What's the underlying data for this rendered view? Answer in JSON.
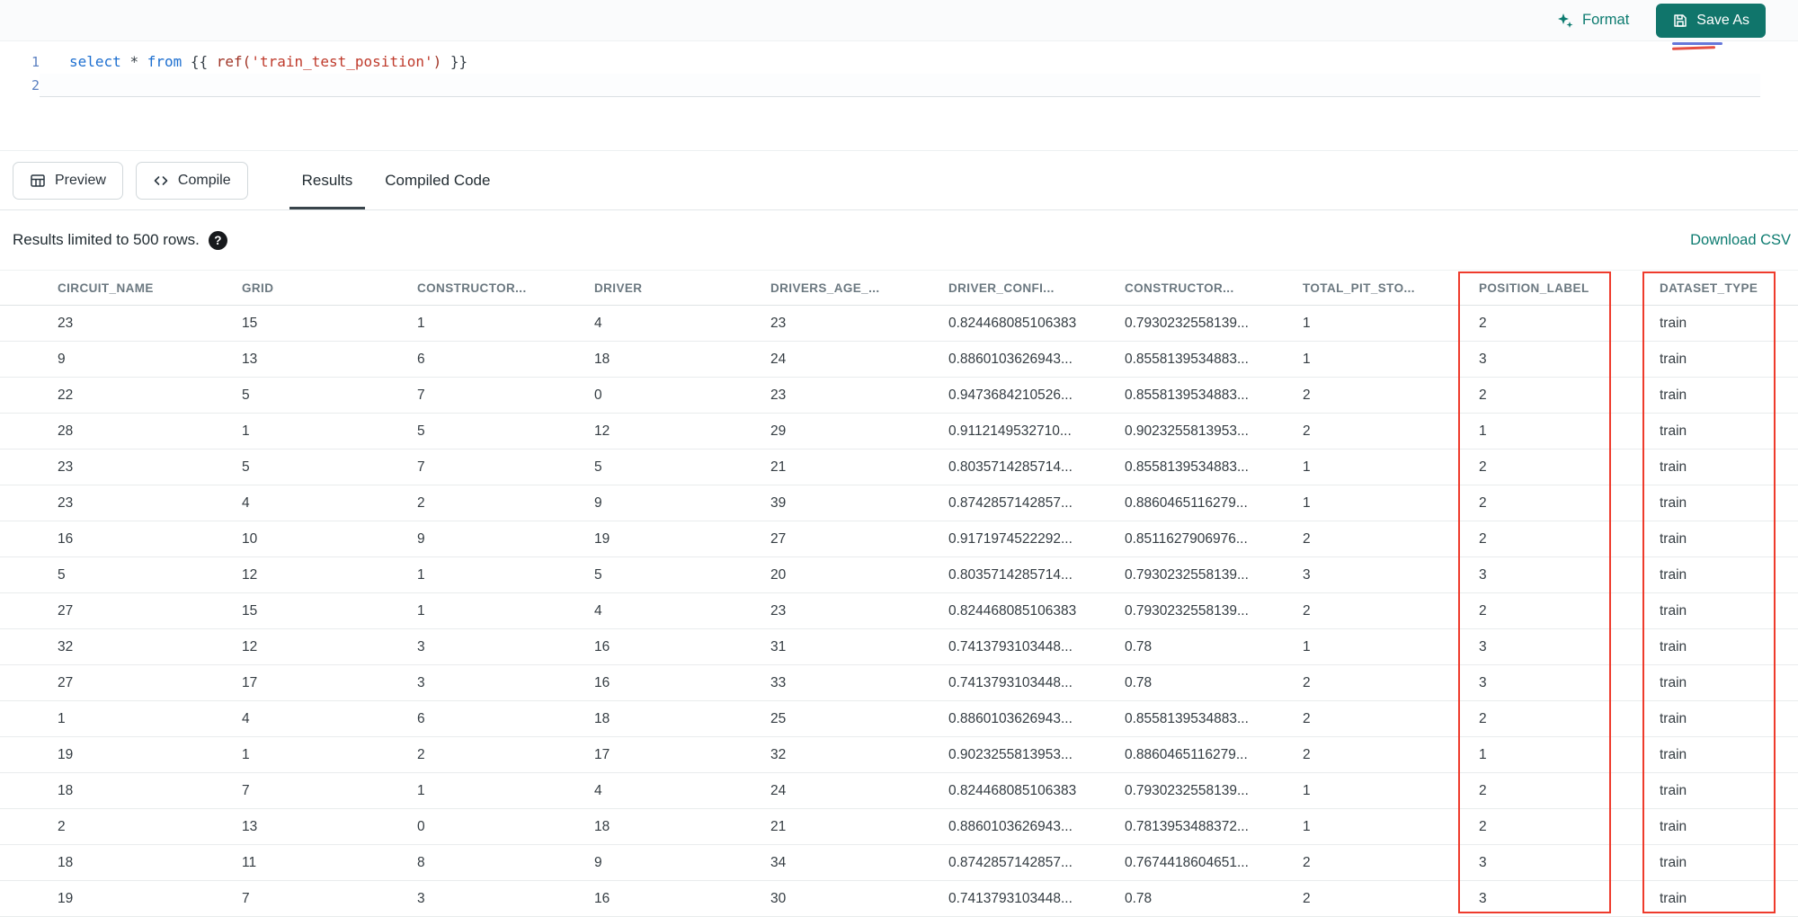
{
  "colors": {
    "accent": "#10756b",
    "link": "#0c7b70",
    "annotation_red": "#ee3b2c",
    "keyword": "#1d6fd0",
    "string": "#bf3a2b",
    "code_plain": "#39424a"
  },
  "topbar": {
    "format_label": "Format",
    "save_as_label": "Save As"
  },
  "editor": {
    "lines": [
      {
        "number": "1",
        "tokens": [
          {
            "type": "keyword",
            "text": "select"
          },
          {
            "type": "plain",
            "text": " "
          },
          {
            "type": "operator",
            "text": "*"
          },
          {
            "type": "plain",
            "text": " "
          },
          {
            "type": "keyword",
            "text": "from"
          },
          {
            "type": "jinja",
            "text": " {{ "
          },
          {
            "type": "function",
            "text": "ref("
          },
          {
            "type": "string",
            "text": "'train_test_position'"
          },
          {
            "type": "function",
            "text": ")"
          },
          {
            "type": "jinja",
            "text": " }}"
          }
        ]
      },
      {
        "number": "2",
        "tokens": []
      }
    ]
  },
  "toolbar": {
    "preview_label": "Preview",
    "compile_label": "Compile",
    "tabs": [
      {
        "label": "Results",
        "active": true
      },
      {
        "label": "Compiled Code",
        "active": false
      }
    ]
  },
  "results": {
    "limit_text": "Results limited to 500 rows.",
    "help_glyph": "?",
    "download_label": "Download CSV"
  },
  "icons": {
    "format": "sparkles-icon",
    "save_as": "save-icon",
    "preview": "table-grid-icon",
    "compile": "code-icon",
    "help": "help-icon"
  },
  "annotations": {
    "highlighted_columns": [
      "POSITION_LABEL",
      "DATASET_TYPE"
    ]
  },
  "table": {
    "columns": [
      "CIRCUIT_NAME",
      "GRID",
      "CONSTRUCTOR...",
      "DRIVER",
      "DRIVERS_AGE_...",
      "DRIVER_CONFI...",
      "CONSTRUCTOR...",
      "TOTAL_PIT_STO...",
      "POSITION_LABEL",
      "DATASET_TYPE"
    ],
    "rows": [
      [
        "23",
        "15",
        "1",
        "4",
        "23",
        "0.824468085106383",
        "0.7930232558139...",
        "1",
        "2",
        "train"
      ],
      [
        "9",
        "13",
        "6",
        "18",
        "24",
        "0.8860103626943...",
        "0.8558139534883...",
        "1",
        "3",
        "train"
      ],
      [
        "22",
        "5",
        "7",
        "0",
        "23",
        "0.9473684210526...",
        "0.8558139534883...",
        "2",
        "2",
        "train"
      ],
      [
        "28",
        "1",
        "5",
        "12",
        "29",
        "0.9112149532710...",
        "0.9023255813953...",
        "2",
        "1",
        "train"
      ],
      [
        "23",
        "5",
        "7",
        "5",
        "21",
        "0.8035714285714...",
        "0.8558139534883...",
        "1",
        "2",
        "train"
      ],
      [
        "23",
        "4",
        "2",
        "9",
        "39",
        "0.8742857142857...",
        "0.8860465116279...",
        "1",
        "2",
        "train"
      ],
      [
        "16",
        "10",
        "9",
        "19",
        "27",
        "0.9171974522292...",
        "0.8511627906976...",
        "2",
        "2",
        "train"
      ],
      [
        "5",
        "12",
        "1",
        "5",
        "20",
        "0.8035714285714...",
        "0.7930232558139...",
        "3",
        "3",
        "train"
      ],
      [
        "27",
        "15",
        "1",
        "4",
        "23",
        "0.824468085106383",
        "0.7930232558139...",
        "2",
        "2",
        "train"
      ],
      [
        "32",
        "12",
        "3",
        "16",
        "31",
        "0.7413793103448...",
        "0.78",
        "1",
        "3",
        "train"
      ],
      [
        "27",
        "17",
        "3",
        "16",
        "33",
        "0.7413793103448...",
        "0.78",
        "2",
        "3",
        "train"
      ],
      [
        "1",
        "4",
        "6",
        "18",
        "25",
        "0.8860103626943...",
        "0.8558139534883...",
        "2",
        "2",
        "train"
      ],
      [
        "19",
        "1",
        "2",
        "17",
        "32",
        "0.9023255813953...",
        "0.8860465116279...",
        "2",
        "1",
        "train"
      ],
      [
        "18",
        "7",
        "1",
        "4",
        "24",
        "0.824468085106383",
        "0.7930232558139...",
        "1",
        "2",
        "train"
      ],
      [
        "2",
        "13",
        "0",
        "18",
        "21",
        "0.8860103626943...",
        "0.7813953488372...",
        "1",
        "2",
        "train"
      ],
      [
        "18",
        "11",
        "8",
        "9",
        "34",
        "0.8742857142857...",
        "0.7674418604651...",
        "2",
        "3",
        "train"
      ],
      [
        "19",
        "7",
        "3",
        "16",
        "30",
        "0.7413793103448...",
        "0.78",
        "2",
        "3",
        "train"
      ]
    ]
  }
}
